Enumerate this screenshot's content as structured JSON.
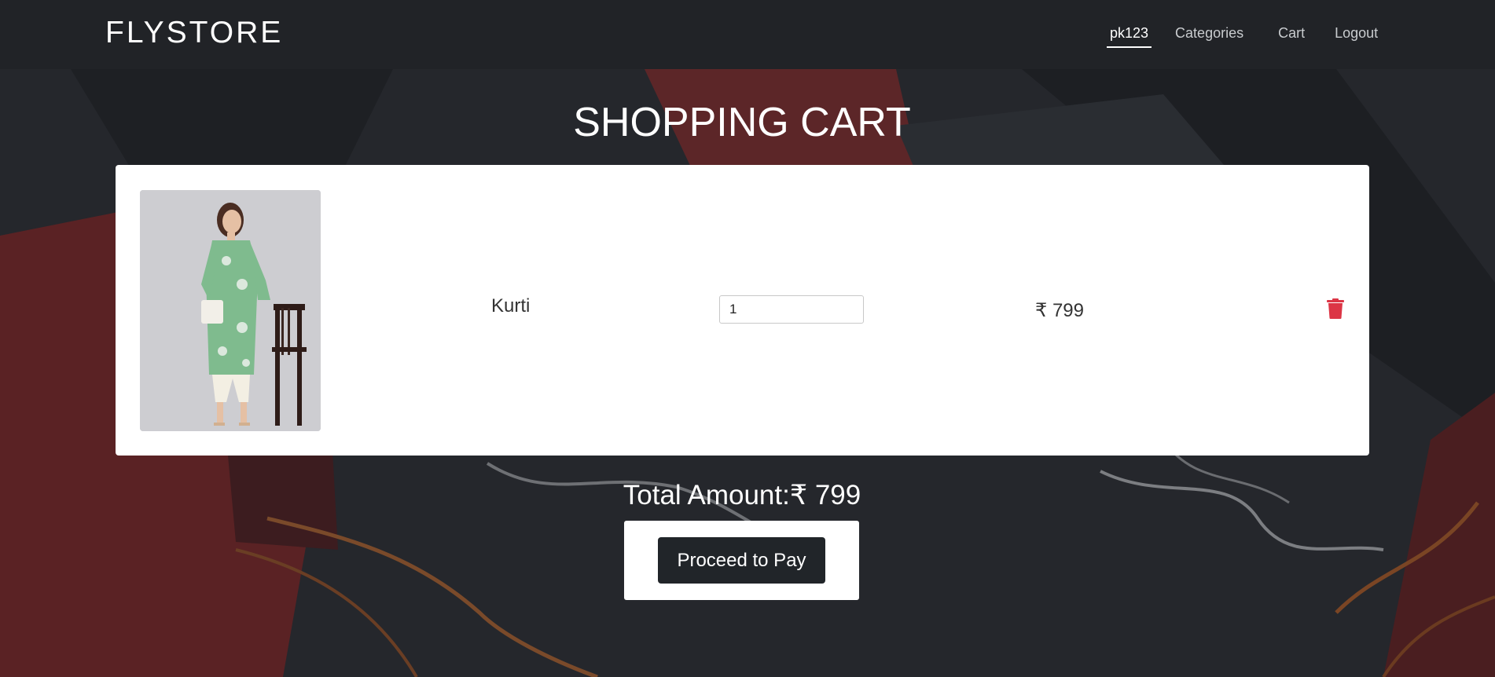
{
  "navbar": {
    "brand": "FLYSTORE",
    "links": {
      "user": "pk123",
      "categories": "Categories",
      "cart": "Cart",
      "logout": "Logout"
    },
    "active_link": "pk123"
  },
  "page": {
    "title": "SHOPPING CART"
  },
  "cart": {
    "items": [
      {
        "name": "Kurti",
        "quantity": "1",
        "price": "₹ 799",
        "image_icon": "kurti-product-image",
        "delete_icon": "trash-icon"
      }
    ]
  },
  "summary": {
    "total_label": "Total Amount:₹ 799",
    "pay_button": "Proceed to Pay"
  },
  "colors": {
    "navbar_bg": "#212327",
    "delete_red": "#dc3545",
    "button_dark": "#212529",
    "card_bg": "#ffffff"
  }
}
